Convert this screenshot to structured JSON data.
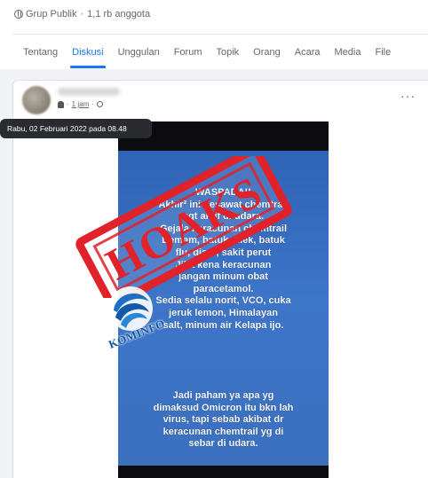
{
  "group": {
    "privacy": "Grup Publik",
    "separator": "·",
    "members": "1,1 rb anggota",
    "icon": "globe-icon"
  },
  "tabs": [
    {
      "label": "Tentang",
      "active": false
    },
    {
      "label": "Diskusi",
      "active": true
    },
    {
      "label": "Unggulan",
      "active": false
    },
    {
      "label": "Forum",
      "active": false
    },
    {
      "label": "Topik",
      "active": false
    },
    {
      "label": "Orang",
      "active": false
    },
    {
      "label": "Acara",
      "active": false
    },
    {
      "label": "Media",
      "active": false
    },
    {
      "label": "File",
      "active": false
    }
  ],
  "post": {
    "time": "1 jam",
    "dot": "·",
    "more_label": "···",
    "tooltip": "Rabu, 02 Februari 2022 pada 08.48",
    "image": {
      "message_top": [
        "WASPADA!!",
        "Akhir² ini pesawat chemtrail",
        "sgt aktif di udara.",
        "Gejala keracunan chemtrail",
        "Demam, batuk pilek, batuk",
        "flu, diare, sakit perut",
        "Jika kena keracunan",
        "jangan minum obat",
        "paracetamol.",
        "Sedia selalu norit, VCO, cuka",
        "jeruk lemon, Himalayan",
        "salt, minum air Kelapa ijo."
      ],
      "message_bottom": [
        "Jadi paham ya apa yg",
        "dimaksud Omicron itu bkn lah",
        "virus, tapi sebab akibat dr",
        "keracunan chemtrail yg di",
        "sebar di udara."
      ],
      "stamp_text": "HOAKS",
      "stamp_color": "#e0222a",
      "logo_text": "KOMINFO",
      "logo_color": "#1458a8"
    }
  },
  "colors": {
    "accent": "#1877f2",
    "text_secondary": "#65676b",
    "feed_background": "#f0f2f5"
  }
}
